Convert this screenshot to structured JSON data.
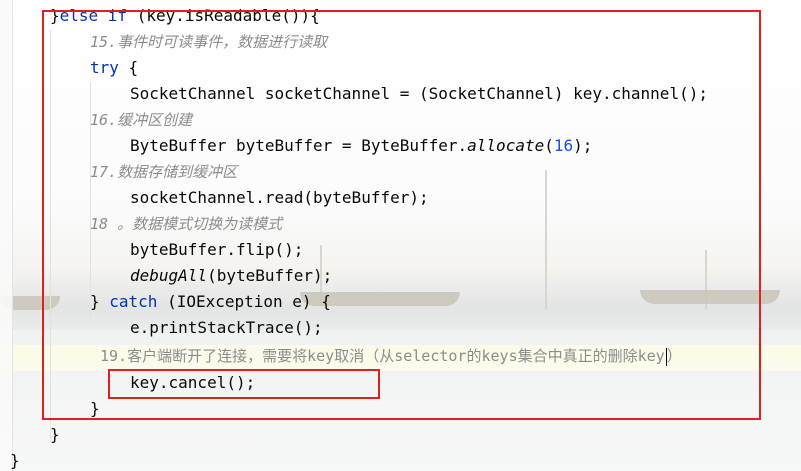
{
  "code": {
    "l0": {
      "a": "}",
      "kw": "else if",
      "b": " (key.isReadable()){"
    },
    "c15": "15.事件时可读事件，数据进行读取",
    "l_try": {
      "kw": "try",
      "b": " {"
    },
    "l_sc": "SocketChannel socketChannel = (SocketChannel) key.channel();",
    "c16": "16.缓冲区创建",
    "l_bb": {
      "a": "ByteBuffer byteBuffer = ByteBuffer.",
      "fn": "allocate",
      "b": "(",
      "num": "16",
      "c": ");"
    },
    "c17": "17.数据存储到缓冲区",
    "l_read": "socketChannel.read(byteBuffer);",
    "c18": {
      "num": "18",
      "text": " 。数据模式切换为读模式"
    },
    "l_flip": "byteBuffer.flip();",
    "l_dbg": {
      "fn": "debugAll",
      "b": "(byteBuffer);"
    },
    "l_catch": {
      "a": "} ",
      "kw": "catch",
      "b": " (IOException e) {"
    },
    "l_print": "e.printStackTrace();",
    "c19": {
      "num": "19.",
      "p1": "客户端断开了连接，需要将",
      "k1": "key",
      "p2": "取消（从",
      "k2": "selector",
      "p3": "的",
      "k3": "keys",
      "p4": "集合中真正的删除",
      "k4": "key",
      "p5": "）"
    },
    "l_cancel": "key.cancel();",
    "l_close1": "}",
    "l_close2": "}",
    "l_close3": "}"
  },
  "colors": {
    "keyword": "#0033b3",
    "comment": "#8c8c8c",
    "number": "#1750eb",
    "highlight_box": "#e02020"
  }
}
